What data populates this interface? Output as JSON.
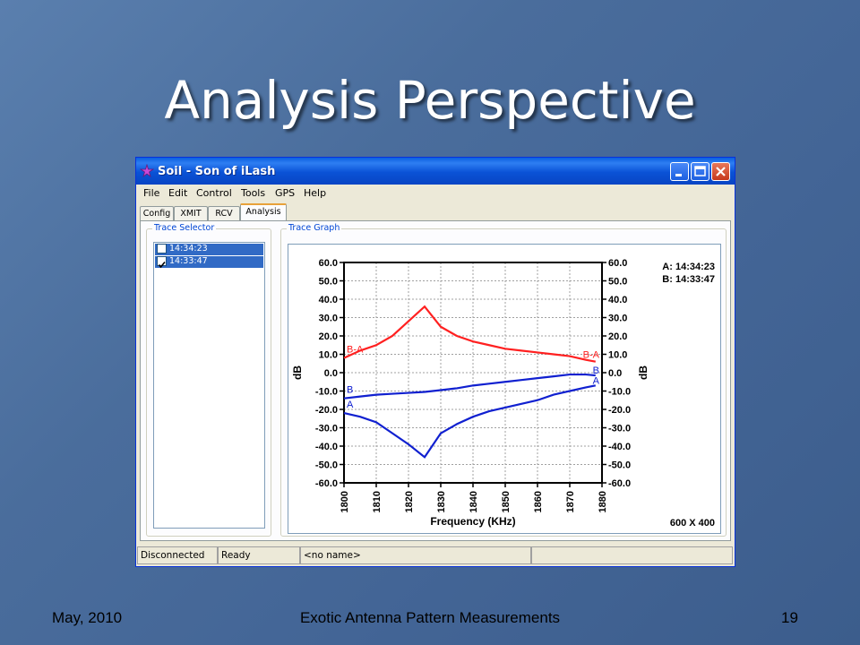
{
  "slide": {
    "title": "Analysis Perspective",
    "footer_left": "May, 2010",
    "footer_center": "Exotic Antenna Pattern Measurements",
    "footer_right": "19"
  },
  "window": {
    "title": "Soil - Son of iLash",
    "menu": [
      "File",
      "Edit",
      "Control",
      "Tools",
      "GPS",
      "Help"
    ],
    "tabs": [
      "Config",
      "XMIT",
      "RCV",
      "Analysis"
    ],
    "active_tab": "Analysis"
  },
  "trace_selector": {
    "label": "Trace Selector",
    "items": [
      {
        "label": "14:34:23",
        "checked": false
      },
      {
        "label": "14:33:47",
        "checked": true
      }
    ]
  },
  "trace_graph": {
    "label": "Trace Graph",
    "legend": [
      "A: 14:34:23",
      "B: 14:33:47"
    ],
    "resolution": "600 X 400"
  },
  "chart_data": {
    "type": "line",
    "xlabel": "Frequency (KHz)",
    "ylabel": "dB",
    "y2label": "dB",
    "xlim": [
      1800,
      1880
    ],
    "ylim": [
      -60,
      60
    ],
    "xticks": [
      "1800",
      "1810",
      "1820",
      "1830",
      "1840",
      "1850",
      "1860",
      "1870",
      "1880"
    ],
    "yticks": [
      "60.0",
      "50.0",
      "40.0",
      "30.0",
      "20.0",
      "10.0",
      "0.0",
      "-10.0",
      "-20.0",
      "-30.0",
      "-40.0",
      "-50.0",
      "-60.0"
    ],
    "grid": true,
    "series": [
      {
        "name": "B-A",
        "color": "#ff2020",
        "points": [
          [
            1800,
            8
          ],
          [
            1805,
            12
          ],
          [
            1810,
            15
          ],
          [
            1815,
            20
          ],
          [
            1820,
            28
          ],
          [
            1825,
            36
          ],
          [
            1830,
            25
          ],
          [
            1835,
            20
          ],
          [
            1840,
            17
          ],
          [
            1845,
            15
          ],
          [
            1850,
            13
          ],
          [
            1855,
            12
          ],
          [
            1860,
            11
          ],
          [
            1865,
            10
          ],
          [
            1870,
            9
          ],
          [
            1875,
            7
          ],
          [
            1878,
            6
          ]
        ]
      },
      {
        "name": "B",
        "color": "#1020d0",
        "points": [
          [
            1800,
            -14
          ],
          [
            1805,
            -13
          ],
          [
            1810,
            -12
          ],
          [
            1815,
            -11.5
          ],
          [
            1820,
            -11
          ],
          [
            1825,
            -10.5
          ],
          [
            1830,
            -9.5
          ],
          [
            1835,
            -8.5
          ],
          [
            1840,
            -7
          ],
          [
            1845,
            -6
          ],
          [
            1850,
            -5
          ],
          [
            1855,
            -4
          ],
          [
            1860,
            -3
          ],
          [
            1865,
            -2
          ],
          [
            1870,
            -1
          ],
          [
            1875,
            -1
          ],
          [
            1878,
            -1.5
          ]
        ]
      },
      {
        "name": "A",
        "color": "#1020d0",
        "points": [
          [
            1800,
            -22
          ],
          [
            1805,
            -24
          ],
          [
            1810,
            -27
          ],
          [
            1815,
            -33
          ],
          [
            1820,
            -39
          ],
          [
            1825,
            -46
          ],
          [
            1830,
            -33
          ],
          [
            1835,
            -28
          ],
          [
            1840,
            -24
          ],
          [
            1845,
            -21
          ],
          [
            1850,
            -19
          ],
          [
            1855,
            -17
          ],
          [
            1860,
            -15
          ],
          [
            1865,
            -12
          ],
          [
            1870,
            -10
          ],
          [
            1875,
            -8
          ],
          [
            1878,
            -7
          ]
        ]
      }
    ],
    "series_labels_left": [
      {
        "text": "B-A",
        "y": 11
      },
      {
        "text": "B",
        "y": -11
      },
      {
        "text": "A",
        "y": -19
      }
    ],
    "series_labels_right": [
      {
        "text": "B-A",
        "y": 8
      },
      {
        "text": "B",
        "y": -0.5
      },
      {
        "text": "A",
        "y": -6
      }
    ]
  },
  "statusbar": [
    "Disconnected",
    "Ready",
    "<no name>"
  ]
}
